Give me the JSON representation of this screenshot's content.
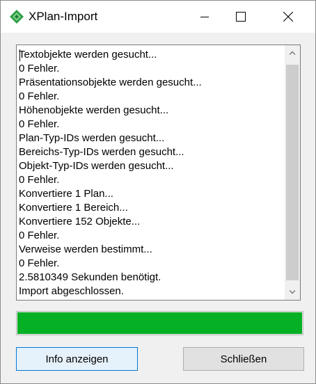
{
  "window": {
    "title": "XPlan-Import",
    "app_icon": "green-diamond-icon",
    "controls": [
      "minimize-icon",
      "maximize-icon",
      "close-icon"
    ]
  },
  "log": {
    "lines": [
      "Textobjekte werden gesucht...",
      "0 Fehler.",
      "Präsentationsobjekte werden gesucht...",
      "0 Fehler.",
      "Höhenobjekte werden gesucht...",
      "0 Fehler.",
      "Plan-Typ-IDs werden gesucht...",
      "Bereichs-Typ-IDs werden gesucht...",
      "Objekt-Typ-IDs werden gesucht...",
      "0 Fehler.",
      "Konvertiere 1 Plan...",
      "Konvertiere 1 Bereich...",
      "Konvertiere 152 Objekte...",
      "0 Fehler.",
      "Verweise werden bestimmt...",
      "0 Fehler.",
      "2.5810349 Sekunden benötigt.",
      "Import abgeschlossen."
    ]
  },
  "progress": {
    "value": 1.0,
    "color": "#06b025"
  },
  "buttons": {
    "info_label": "Info anzeigen",
    "close_label": "Schließen"
  }
}
